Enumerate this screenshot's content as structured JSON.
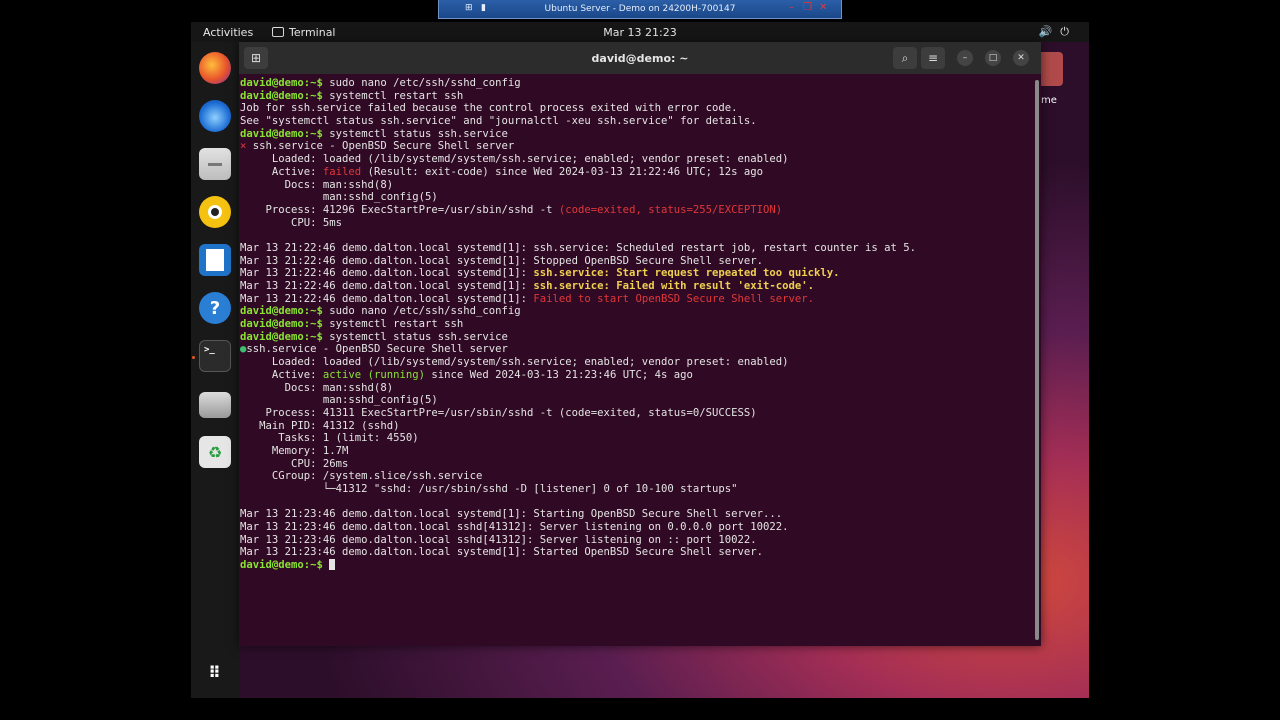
{
  "viewer": {
    "title": "Ubuntu Server - Demo on 24200H-700147"
  },
  "topbar": {
    "activities": "Activities",
    "app": "Terminal",
    "clock": "Mar 13  21:23"
  },
  "desktop": {
    "home_label": "me"
  },
  "terminal": {
    "title": "david@demo: ~",
    "prompt": "david@demo:~$",
    "lines": [
      {
        "t": "prompt",
        "cmd": " sudo nano /etc/ssh/sshd_config"
      },
      {
        "t": "prompt",
        "cmd": " systemctl restart ssh"
      },
      {
        "t": "plain",
        "text": "Job for ssh.service failed because the control process exited with error code."
      },
      {
        "t": "plain",
        "text": "See \"systemctl status ssh.service\" and \"journalctl -xeu ssh.service\" for details."
      },
      {
        "t": "prompt",
        "cmd": " systemctl status ssh.service"
      },
      {
        "t": "status",
        "mark": "×",
        "text": " ssh.service - OpenBSD Secure Shell server"
      },
      {
        "t": "plain",
        "text": "     Loaded: loaded (/lib/systemd/system/ssh.service; enabled; vendor preset: enabled)"
      },
      {
        "t": "kv",
        "a": "     Active: ",
        "b": "failed",
        "c": " (Result: exit-code) since Wed 2024-03-13 21:22:46 UTC; 12s ago",
        "cls": "r"
      },
      {
        "t": "plain",
        "text": "       Docs: man:sshd(8)"
      },
      {
        "t": "plain",
        "text": "             man:sshd_config(5)"
      },
      {
        "t": "kv",
        "a": "    Process: 41296 ExecStartPre=/usr/sbin/sshd -t ",
        "b": "(code=exited, status=255/EXCEPTION)",
        "c": "",
        "cls": "r"
      },
      {
        "t": "plain",
        "text": "        CPU: 5ms"
      },
      {
        "t": "plain",
        "text": ""
      },
      {
        "t": "plain",
        "text": "Mar 13 21:22:46 demo.dalton.local systemd[1]: ssh.service: Scheduled restart job, restart counter is at 5."
      },
      {
        "t": "plain",
        "text": "Mar 13 21:22:46 demo.dalton.local systemd[1]: Stopped OpenBSD Secure Shell server."
      },
      {
        "t": "kv",
        "a": "Mar 13 21:22:46 demo.dalton.local systemd[1]: ",
        "b": "ssh.service: Start request repeated too quickly.",
        "c": "",
        "cls": "y"
      },
      {
        "t": "kv",
        "a": "Mar 13 21:22:46 demo.dalton.local systemd[1]: ",
        "b": "ssh.service: Failed with result 'exit-code'.",
        "c": "",
        "cls": "y"
      },
      {
        "t": "kv",
        "a": "Mar 13 21:22:46 demo.dalton.local systemd[1]: ",
        "b": "Failed to start OpenBSD Secure Shell server.",
        "c": "",
        "cls": "r"
      },
      {
        "t": "prompt",
        "cmd": " sudo nano /etc/ssh/sshd_config"
      },
      {
        "t": "prompt",
        "cmd": " systemctl restart ssh"
      },
      {
        "t": "prompt",
        "cmd": " systemctl status ssh.service"
      },
      {
        "t": "status_ok",
        "mark": "●",
        "text": "ssh.service - OpenBSD Secure Shell server"
      },
      {
        "t": "plain",
        "text": "     Loaded: loaded (/lib/systemd/system/ssh.service; enabled; vendor preset: enabled)"
      },
      {
        "t": "kv",
        "a": "     Active: ",
        "b": "active (running)",
        "c": " since Wed 2024-03-13 21:23:46 UTC; 4s ago",
        "cls": "g"
      },
      {
        "t": "plain",
        "text": "       Docs: man:sshd(8)"
      },
      {
        "t": "plain",
        "text": "             man:sshd_config(5)"
      },
      {
        "t": "plain",
        "text": "    Process: 41311 ExecStartPre=/usr/sbin/sshd -t (code=exited, status=0/SUCCESS)"
      },
      {
        "t": "plain",
        "text": "   Main PID: 41312 (sshd)"
      },
      {
        "t": "plain",
        "text": "      Tasks: 1 (limit: 4550)"
      },
      {
        "t": "plain",
        "text": "     Memory: 1.7M"
      },
      {
        "t": "plain",
        "text": "        CPU: 26ms"
      },
      {
        "t": "plain",
        "text": "     CGroup: /system.slice/ssh.service"
      },
      {
        "t": "plain",
        "text": "             └─41312 \"sshd: /usr/sbin/sshd -D [listener] 0 of 10-100 startups\""
      },
      {
        "t": "plain",
        "text": ""
      },
      {
        "t": "plain",
        "text": "Mar 13 21:23:46 demo.dalton.local systemd[1]: Starting OpenBSD Secure Shell server..."
      },
      {
        "t": "plain",
        "text": "Mar 13 21:23:46 demo.dalton.local sshd[41312]: Server listening on 0.0.0.0 port 10022."
      },
      {
        "t": "plain",
        "text": "Mar 13 21:23:46 demo.dalton.local sshd[41312]: Server listening on :: port 10022."
      },
      {
        "t": "plain",
        "text": "Mar 13 21:23:46 demo.dalton.local systemd[1]: Started OpenBSD Secure Shell server."
      },
      {
        "t": "cursor",
        "cmd": " "
      }
    ]
  }
}
